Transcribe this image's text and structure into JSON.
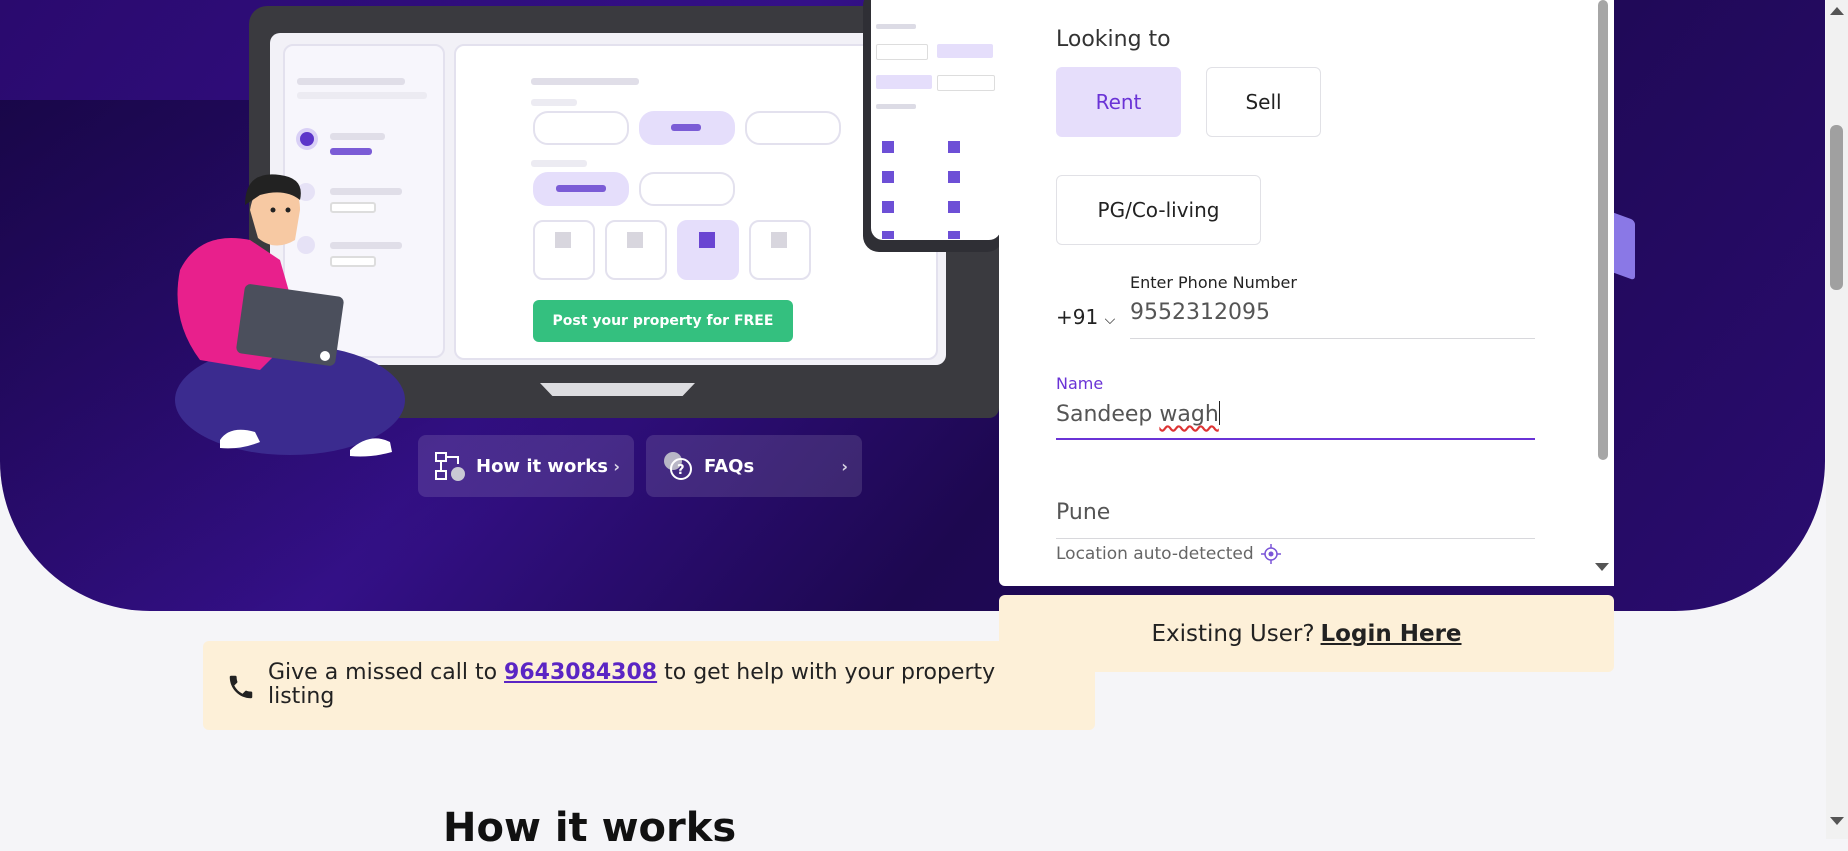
{
  "hero": {
    "post_button_label": "Post your property for FREE",
    "how_it_works_label": "How it works",
    "faqs_label": "FAQs"
  },
  "form": {
    "looking_to_label": "Looking to",
    "options": [
      "Rent",
      "Sell",
      "PG/Co-living"
    ],
    "selected_option": "Rent",
    "country_code": "+91",
    "phone_label": "Enter Phone Number",
    "phone_value": "9552312095",
    "name_label": "Name",
    "name_value_first": "Sandeep",
    "name_value_second": "wagh",
    "city_value": "Pune",
    "location_note": "Location auto-detected"
  },
  "login": {
    "prompt": "Existing User?",
    "link_label": "Login Here"
  },
  "missed_call": {
    "text_before": "Give a missed call to",
    "phone_number": "9643084308",
    "text_after": "to get help with your property listing"
  },
  "section": {
    "title": "How it works"
  },
  "colors": {
    "accent": "#6a33d6",
    "hero_bg": "#2a0a6e",
    "cta_green": "#34c07f",
    "highlight_bg": "#fdf0d8"
  },
  "icons": {
    "how_it_works": "flowchart-icon",
    "faqs": "question-bubble-icon",
    "missed_call": "phone-icon",
    "location": "crosshair-icon"
  }
}
